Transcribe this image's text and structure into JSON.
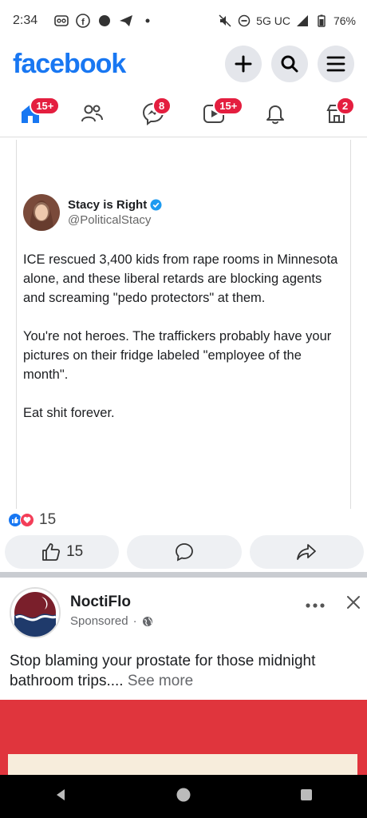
{
  "status_bar": {
    "time": "2:34",
    "network": "5G UC",
    "battery": "76%"
  },
  "header": {
    "logo": "facebook"
  },
  "nav": {
    "badges": {
      "home": "15+",
      "messenger": "8",
      "video": "15+",
      "marketplace": "2"
    }
  },
  "post": {
    "author_name": "Stacy is Right",
    "author_handle": "@PoliticalStacy",
    "paragraphs": [
      "ICE rescued 3,400 kids from rape rooms in Minnesota alone, and these liberal retards are blocking agents and screaming \"pedo protectors\" at them.",
      "You're not heroes. The traffickers probably have your pictures on their fridge labeled \"employee of the month\".",
      "Eat shit forever."
    ],
    "reaction_count": "15",
    "like_count": "15"
  },
  "ad": {
    "name": "NoctiFlo",
    "sponsored_label": "Sponsored",
    "text": "Stop blaming your prostate for those midnight bathroom trips....",
    "see_more": " See more"
  },
  "colors": {
    "brand": "#1877f2",
    "badge": "#e41e3f",
    "ad_banner": "#e0353d"
  }
}
